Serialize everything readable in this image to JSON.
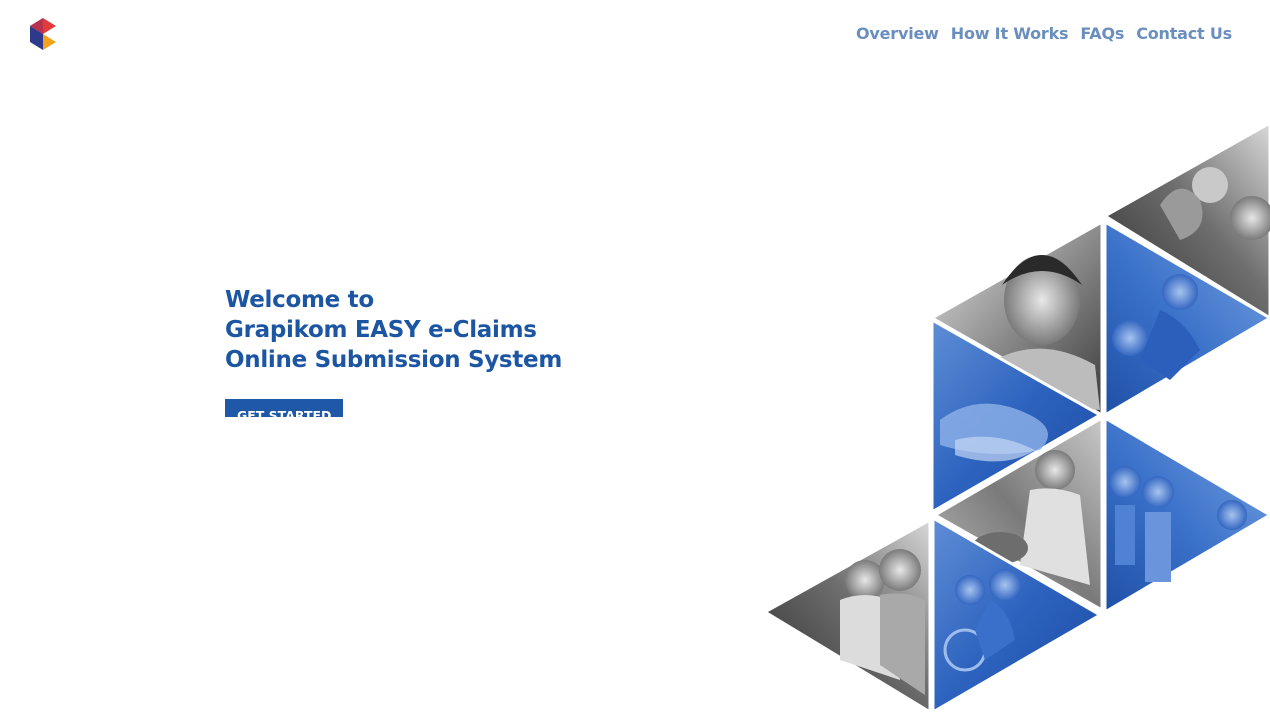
{
  "brand": {
    "colors": {
      "primary_blue": "#1c56a3",
      "nav_blue": "#6a8fbf",
      "button_blue": "#1f58a7",
      "logo_red": "#e23b3b",
      "logo_purple": "#2d3a8c",
      "logo_orange": "#f4a21d"
    }
  },
  "nav": {
    "items": [
      {
        "label": "Overview"
      },
      {
        "label": "How It Works"
      },
      {
        "label": "FAQs"
      },
      {
        "label": "Contact Us"
      }
    ]
  },
  "hero": {
    "line1": "Welcome to",
    "line2": "Grapikom EASY e-Claims",
    "line3": "Online Submission System",
    "cta_label": "GET STARTED"
  }
}
